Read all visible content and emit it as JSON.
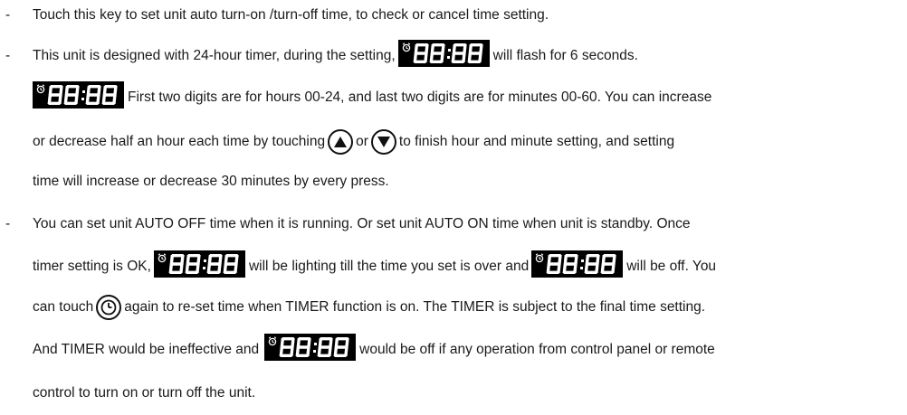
{
  "bullet_dash": "-",
  "display_icon_name": "led-timer-display-icon",
  "lines": [
    {
      "segs": [
        "Touch this key to set unit auto turn-on /turn-off time, to check or cancel time setting."
      ]
    },
    {
      "segs": [
        "This unit is designed with 24-hour timer, during the setting,",
        "will flash for 6 seconds."
      ]
    },
    {
      "segs": [
        "First two digits are for hours 00-24, and last two digits are for minutes 00-60. You can increase"
      ]
    },
    {
      "segs": [
        "or decrease half an hour each time by touching",
        "or",
        "to finish hour and minute setting, and setting"
      ]
    },
    {
      "segs": [
        "time will increase or decrease 30 minutes by every press."
      ]
    },
    {
      "segs": [
        "You can set unit AUTO OFF time when it is running. Or set unit AUTO ON time when unit is standby. Once"
      ]
    },
    {
      "segs": [
        "timer setting is OK,",
        "will be lighting till the time you set is over and",
        "will be off. You"
      ]
    },
    {
      "segs": [
        "can touch",
        "again to re-set time when TIMER function is on. The TIMER is subject to the final time setting."
      ]
    },
    {
      "segs": [
        "And TIMER would be ineffective and",
        "would be off if any operation from control panel or remote"
      ]
    },
    {
      "segs": [
        "control to turn on or turn off the unit."
      ]
    }
  ]
}
